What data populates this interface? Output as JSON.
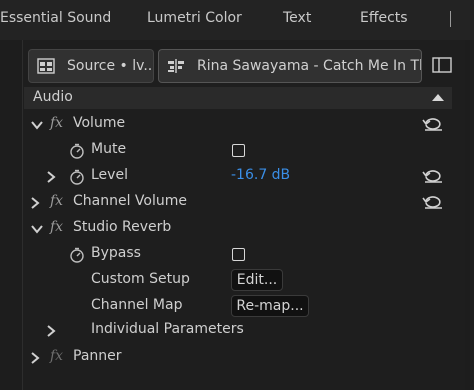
{
  "tabs": [
    {
      "label": "Essential Sound"
    },
    {
      "label": "Lumetri Color"
    },
    {
      "label": "Text"
    },
    {
      "label": "Effects"
    }
  ],
  "source_clip": {
    "label": "Source • lv..."
  },
  "timeline_clip": {
    "label": "Rina Sawayama - Catch Me In The..."
  },
  "section": {
    "title": "Audio"
  },
  "effects": {
    "volume": {
      "name": "Volume"
    },
    "mute": {
      "label": "Mute"
    },
    "level": {
      "label": "Level",
      "value": "-16.7 dB"
    },
    "channel_volume": {
      "name": "Channel Volume"
    },
    "studio_reverb": {
      "name": "Studio Reverb"
    },
    "bypass": {
      "label": "Bypass"
    },
    "custom_setup": {
      "label": "Custom Setup",
      "button": "Edit..."
    },
    "channel_map": {
      "label": "Channel Map",
      "button": "Re-map..."
    },
    "individual_parameters": {
      "label": "Individual Parameters"
    },
    "panner": {
      "name": "Panner"
    }
  },
  "colors": {
    "accent_value": "#3a8ee6",
    "background": "#1d1d1d"
  },
  "icons": [
    "source-clip-icon",
    "timeline-clip-icon",
    "panel-toggle-icon",
    "fx-icon",
    "stopwatch-icon",
    "reset-icon",
    "chevron-down-icon",
    "chevron-right-icon",
    "collapse-caret-icon"
  ]
}
